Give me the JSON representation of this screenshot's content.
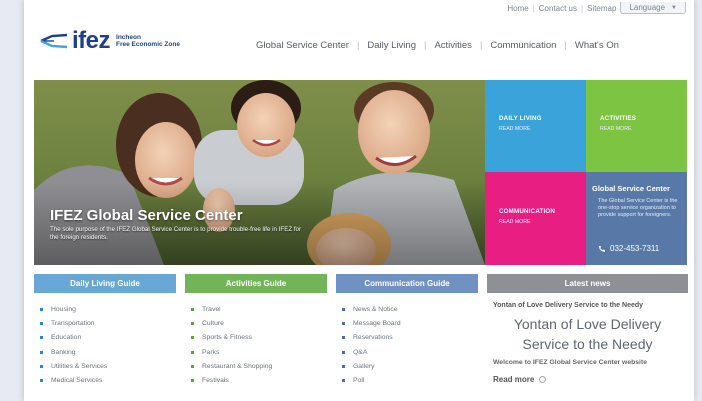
{
  "topbar": {
    "home": "Home",
    "contact": "Contact us",
    "sitemap": "Sitemap",
    "language": "Language"
  },
  "logo": {
    "word": "ifez",
    "line1": "Incheon",
    "line2": "Free Economic Zone"
  },
  "gnb": [
    "Global Service Center",
    "Daily Living",
    "Activities",
    "Communication",
    "What's On"
  ],
  "hero": {
    "title": "IFEZ Global Service Center",
    "desc": "The sole purpose of the IFEZ Global Service Center is to provide trouble-free life in IFEZ for the foreign residents."
  },
  "tiles": {
    "daily": {
      "title": "DAILY LIVING",
      "more": "READ MORE"
    },
    "activities": {
      "title": "ACTIVITIES",
      "more": "READ MORE"
    },
    "communication": {
      "title": "COMMUNICATION",
      "more": "READ MORE"
    },
    "gsc": {
      "title": "Global Service Center",
      "desc": "The Global Service Center is the one-stop service organization to provide support for foreigners.",
      "phone": "032-453-7311"
    }
  },
  "daily_guide": {
    "title": "Daily Living Guide",
    "items": [
      "Housing",
      "Transportation",
      "Education",
      "Banking",
      "Utilities & Services",
      "Medical Services"
    ]
  },
  "activities_guide": {
    "title": "Activities Guide",
    "items": [
      "Travel",
      "Culture",
      "Sports & Fitness",
      "Parks",
      "Restaurant & Shopping",
      "Festivals"
    ]
  },
  "communication_guide": {
    "title": "Communication Guide",
    "items": [
      "News & Notice",
      "Message Board",
      "Reservations",
      "Q&A",
      "Gallery",
      "Poll"
    ]
  },
  "news": {
    "title": "Latest news",
    "headline": "Yontan of Love Delivery Service to the Needy",
    "big_line1": "Yontan of Love Delivery",
    "big_line2": "Service to the Needy",
    "sub": "Welcome to IFEZ Global Service Center website",
    "read_more": "Read more"
  },
  "colors": {
    "daily": "#3aa4da",
    "activities": "#7cc441",
    "communication": "#e81e83",
    "gsc": "#5878a8"
  }
}
